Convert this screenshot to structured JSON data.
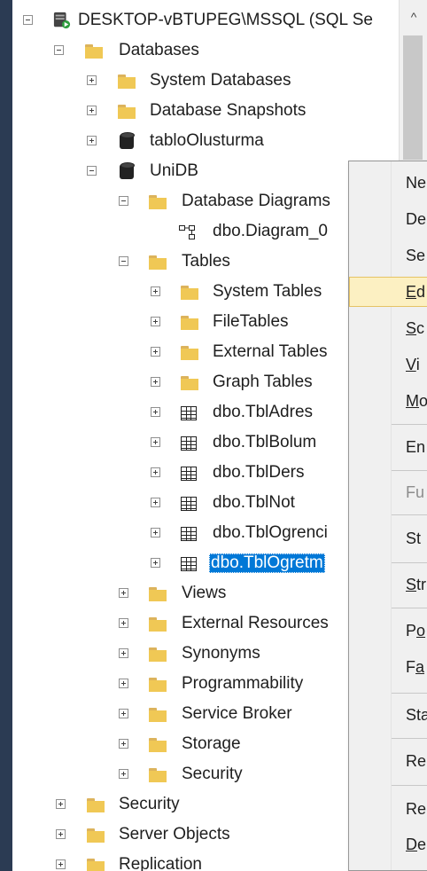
{
  "tree": {
    "server": "DESKTOP-vBTUPEG\\MSSQL (SQL Se",
    "databases": "Databases",
    "system_databases": "System Databases",
    "database_snapshots": "Database Snapshots",
    "db_tablo": "tabloOlusturma",
    "db_unidb": "UniDB",
    "database_diagrams": "Database Diagrams",
    "diagram_item": "dbo.Diagram_0",
    "tables": "Tables",
    "system_tables": "System Tables",
    "file_tables": "FileTables",
    "external_tables": "External Tables",
    "graph_tables": "Graph Tables",
    "tbl_adres": "dbo.TblAdres",
    "tbl_bolum": "dbo.TblBolum",
    "tbl_ders": "dbo.TblDers",
    "tbl_not": "dbo.TblNot",
    "tbl_ogrenci": "dbo.TblOgrenci",
    "tbl_ogretmen": "dbo.TblOgretm",
    "views": "Views",
    "external_resources": "External Resources",
    "synonyms": "Synonyms",
    "programmability": "Programmability",
    "service_broker": "Service Broker",
    "storage": "Storage",
    "security_db": "Security",
    "security_server": "Security",
    "server_objects": "Server Objects",
    "replication": "Replication"
  },
  "context_menu": {
    "items": [
      {
        "text": "Ne"
      },
      {
        "text": "De"
      },
      {
        "text": "Se"
      },
      {
        "text": "Ed",
        "underline": "E",
        "rest": "d"
      },
      {
        "underline": "S",
        "rest": "c"
      },
      {
        "underline": "V",
        "rest": "i"
      },
      {
        "underline": "M",
        "rest": "o"
      },
      {
        "text": "En"
      },
      {
        "text": "Fu"
      },
      {
        "text": "St"
      },
      {
        "underline": "S",
        "rest": "tr"
      },
      {
        "pre": "P",
        "underline": "o"
      },
      {
        "pre": "F",
        "underline": "a"
      },
      {
        "text": "Sta"
      },
      {
        "text": "Re"
      },
      {
        "text": "Re"
      },
      {
        "underline": "D",
        "rest": "e"
      }
    ]
  },
  "scrollbar": {
    "up_arrow": "^"
  },
  "colors": {
    "selection": "#0078d7",
    "folder": "#f0c855",
    "menu_highlight": "#fcf0c2",
    "left_border": "#2b3b53"
  }
}
